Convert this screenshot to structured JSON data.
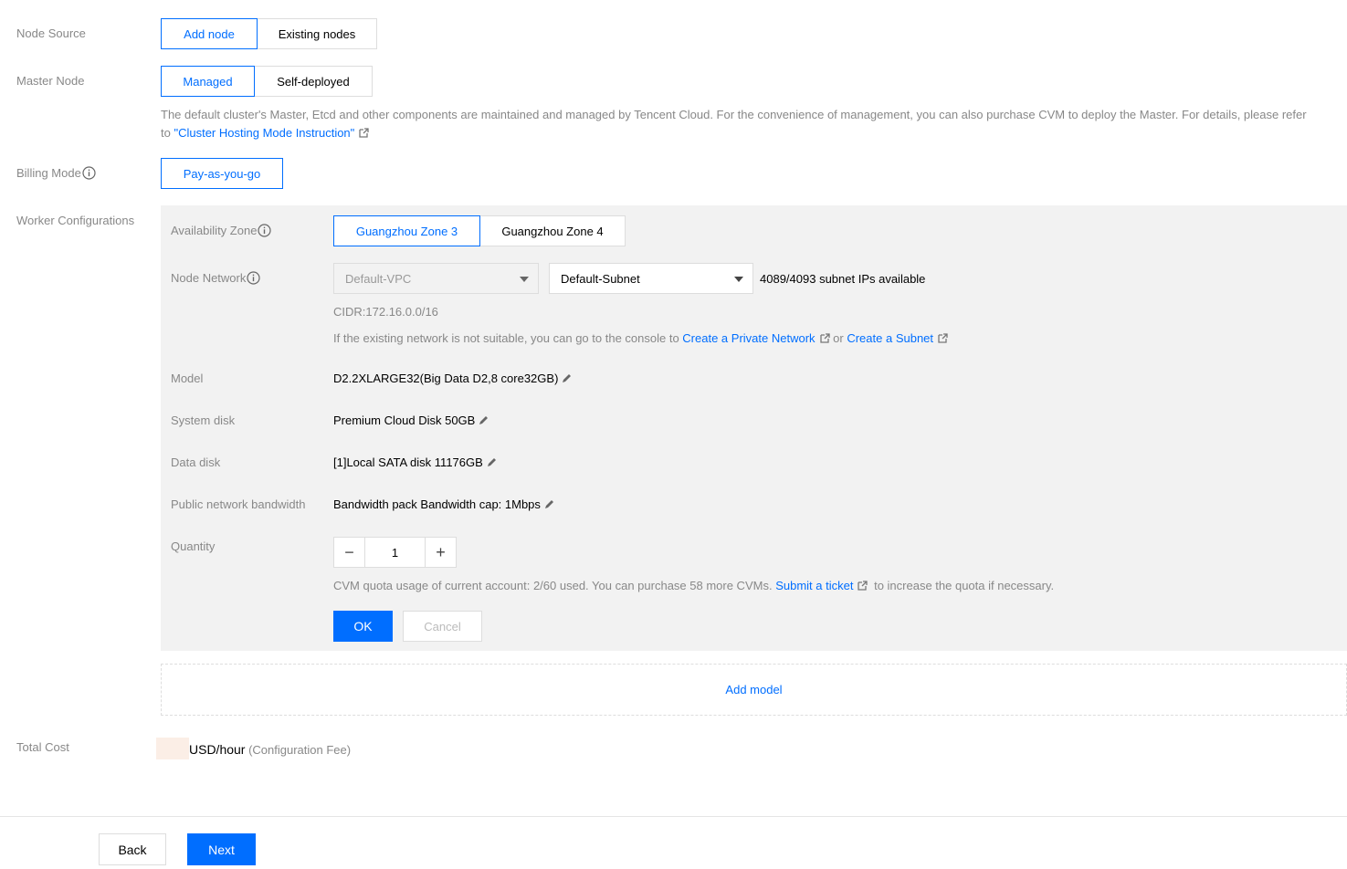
{
  "node_source": {
    "label": "Node Source",
    "options": [
      "Add node",
      "Existing nodes"
    ],
    "selected": "Add node"
  },
  "master_node": {
    "label": "Master Node",
    "options": [
      "Managed",
      "Self-deployed"
    ],
    "selected": "Managed",
    "desc_line1": "The default cluster's Master, Etcd and other components are maintained and managed by Tencent Cloud. For the convenience of management, you can also purchase CVM to deploy the Master. For details, please refer",
    "desc_prefix": "to ",
    "desc_link": "\"Cluster Hosting Mode Instruction\""
  },
  "billing_mode": {
    "label": "Billing Mode",
    "option": "Pay-as-you-go"
  },
  "worker": {
    "label": "Worker Configurations",
    "availability_zone": {
      "label": "Availability Zone",
      "options": [
        "Guangzhou Zone 3",
        "Guangzhou Zone 4"
      ],
      "selected": "Guangzhou Zone 3"
    },
    "node_network": {
      "label": "Node Network",
      "vpc": "Default-VPC",
      "subnet": "Default-Subnet",
      "available": "4089/4093 subnet IPs available",
      "cidr": "CIDR:172.16.0.0/16",
      "hint_prefix": "If the existing network is not suitable, you can go to the console to",
      "link_private": "Create a Private Network",
      "hint_or": "or",
      "link_subnet": "Create a Subnet"
    },
    "model": {
      "label": "Model",
      "value": "D2.2XLARGE32(Big Data D2,8 core32GB)"
    },
    "system_disk": {
      "label": "System disk",
      "value": "Premium Cloud Disk 50GB"
    },
    "data_disk": {
      "label": "Data disk",
      "value": "[1]Local SATA disk 11176GB"
    },
    "bandwidth": {
      "label": "Public network bandwidth",
      "value": "Bandwidth pack Bandwidth cap: 1Mbps"
    },
    "quantity": {
      "label": "Quantity",
      "value": "1",
      "decrement": "−",
      "increment": "+",
      "quota_text": "CVM quota usage of current account: 2/60 used. You can purchase 58 more CVMs.",
      "quota_link": "Submit a ticket",
      "quota_suffix": "to increase the quota if necessary."
    },
    "ok_label": "OK",
    "cancel_label": "Cancel"
  },
  "add_model": "Add model",
  "total_cost": {
    "label": "Total Cost",
    "unit": "USD/hour",
    "note": "(Configuration Fee)"
  },
  "footer": {
    "back_label": "Back",
    "next_label": "Next"
  },
  "colors": {
    "accent": "#006eff",
    "panel_bg": "#f2f2f2",
    "label_gray": "#888888"
  },
  "icons": {
    "info": "info-icon",
    "external": "external-link-icon",
    "edit": "pencil-icon",
    "dropdown": "caret-down-icon"
  }
}
